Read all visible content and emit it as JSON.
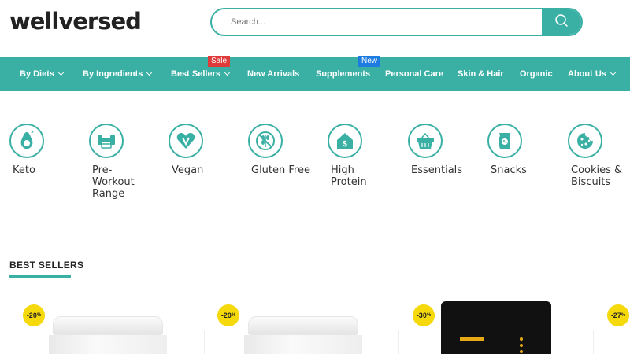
{
  "brand": {
    "logo_text": "wellversed"
  },
  "search": {
    "placeholder": "Search...",
    "button_icon": "search-icon"
  },
  "nav": {
    "items": [
      {
        "label": "By Diets",
        "has_dropdown": true
      },
      {
        "label": "By Ingredients",
        "has_dropdown": true
      },
      {
        "label": "Best Sellers",
        "has_dropdown": true,
        "badge": "Sale"
      },
      {
        "label": "New Arrivals",
        "has_dropdown": false
      },
      {
        "label": "Supplements",
        "has_dropdown": false,
        "badge": "New"
      },
      {
        "label": "Personal Care",
        "has_dropdown": false
      },
      {
        "label": "Skin & Hair",
        "has_dropdown": false
      },
      {
        "label": "Organic",
        "has_dropdown": false
      },
      {
        "label": "About Us",
        "has_dropdown": true
      }
    ]
  },
  "categories": [
    {
      "label": "Keto",
      "icon": "avocado-icon"
    },
    {
      "label": "Pre-\nWorkout\nRange",
      "icon": "dumbbell-icon"
    },
    {
      "label": "Vegan",
      "icon": "vegan-heart-icon"
    },
    {
      "label": "Gluten Free",
      "icon": "no-wheat-icon"
    },
    {
      "label": "High\nProtein",
      "icon": "protein-house-icon"
    },
    {
      "label": "Essentials",
      "icon": "basket-icon"
    },
    {
      "label": "Snacks",
      "icon": "snack-pack-icon"
    },
    {
      "label": "Cookies &\nBiscuits",
      "icon": "cookie-icon"
    }
  ],
  "best_sellers": {
    "title": "BEST SELLERS",
    "products": [
      {
        "discount": "-20",
        "discount_unit": "%",
        "image": "white-jar"
      },
      {
        "discount": "-20",
        "discount_unit": "%",
        "image": "white-jar"
      },
      {
        "discount": "-30",
        "discount_unit": "%",
        "image": "black-pouch"
      },
      {
        "discount": "-27",
        "discount_unit": "%",
        "image": "partial"
      }
    ]
  },
  "colors": {
    "accent": "#3ab0a5",
    "sale_badge": "#e03b3b",
    "new_badge": "#1e7be0",
    "discount_badge": "#f5d90a"
  }
}
